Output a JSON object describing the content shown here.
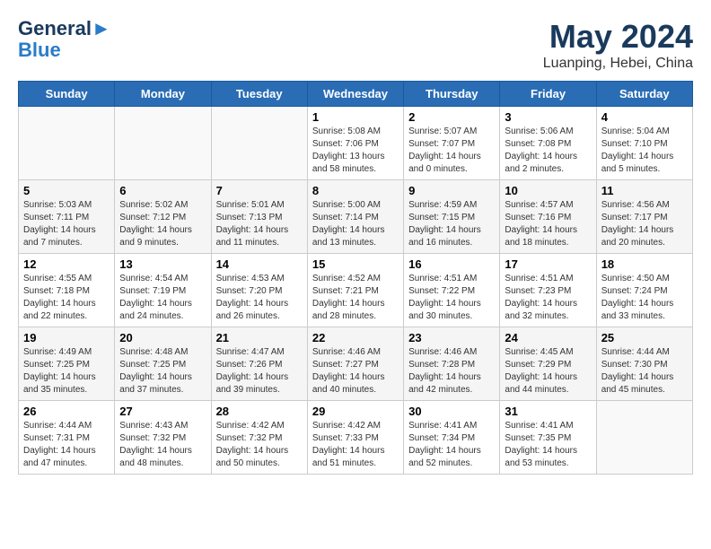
{
  "header": {
    "logo_line1": "General",
    "logo_line2": "Blue",
    "month": "May 2024",
    "location": "Luanping, Hebei, China"
  },
  "weekdays": [
    "Sunday",
    "Monday",
    "Tuesday",
    "Wednesday",
    "Thursday",
    "Friday",
    "Saturday"
  ],
  "weeks": [
    [
      {
        "day": "",
        "info": ""
      },
      {
        "day": "",
        "info": ""
      },
      {
        "day": "",
        "info": ""
      },
      {
        "day": "1",
        "info": "Sunrise: 5:08 AM\nSunset: 7:06 PM\nDaylight: 13 hours\nand 58 minutes."
      },
      {
        "day": "2",
        "info": "Sunrise: 5:07 AM\nSunset: 7:07 PM\nDaylight: 14 hours\nand 0 minutes."
      },
      {
        "day": "3",
        "info": "Sunrise: 5:06 AM\nSunset: 7:08 PM\nDaylight: 14 hours\nand 2 minutes."
      },
      {
        "day": "4",
        "info": "Sunrise: 5:04 AM\nSunset: 7:10 PM\nDaylight: 14 hours\nand 5 minutes."
      }
    ],
    [
      {
        "day": "5",
        "info": "Sunrise: 5:03 AM\nSunset: 7:11 PM\nDaylight: 14 hours\nand 7 minutes."
      },
      {
        "day": "6",
        "info": "Sunrise: 5:02 AM\nSunset: 7:12 PM\nDaylight: 14 hours\nand 9 minutes."
      },
      {
        "day": "7",
        "info": "Sunrise: 5:01 AM\nSunset: 7:13 PM\nDaylight: 14 hours\nand 11 minutes."
      },
      {
        "day": "8",
        "info": "Sunrise: 5:00 AM\nSunset: 7:14 PM\nDaylight: 14 hours\nand 13 minutes."
      },
      {
        "day": "9",
        "info": "Sunrise: 4:59 AM\nSunset: 7:15 PM\nDaylight: 14 hours\nand 16 minutes."
      },
      {
        "day": "10",
        "info": "Sunrise: 4:57 AM\nSunset: 7:16 PM\nDaylight: 14 hours\nand 18 minutes."
      },
      {
        "day": "11",
        "info": "Sunrise: 4:56 AM\nSunset: 7:17 PM\nDaylight: 14 hours\nand 20 minutes."
      }
    ],
    [
      {
        "day": "12",
        "info": "Sunrise: 4:55 AM\nSunset: 7:18 PM\nDaylight: 14 hours\nand 22 minutes."
      },
      {
        "day": "13",
        "info": "Sunrise: 4:54 AM\nSunset: 7:19 PM\nDaylight: 14 hours\nand 24 minutes."
      },
      {
        "day": "14",
        "info": "Sunrise: 4:53 AM\nSunset: 7:20 PM\nDaylight: 14 hours\nand 26 minutes."
      },
      {
        "day": "15",
        "info": "Sunrise: 4:52 AM\nSunset: 7:21 PM\nDaylight: 14 hours\nand 28 minutes."
      },
      {
        "day": "16",
        "info": "Sunrise: 4:51 AM\nSunset: 7:22 PM\nDaylight: 14 hours\nand 30 minutes."
      },
      {
        "day": "17",
        "info": "Sunrise: 4:51 AM\nSunset: 7:23 PM\nDaylight: 14 hours\nand 32 minutes."
      },
      {
        "day": "18",
        "info": "Sunrise: 4:50 AM\nSunset: 7:24 PM\nDaylight: 14 hours\nand 33 minutes."
      }
    ],
    [
      {
        "day": "19",
        "info": "Sunrise: 4:49 AM\nSunset: 7:25 PM\nDaylight: 14 hours\nand 35 minutes."
      },
      {
        "day": "20",
        "info": "Sunrise: 4:48 AM\nSunset: 7:25 PM\nDaylight: 14 hours\nand 37 minutes."
      },
      {
        "day": "21",
        "info": "Sunrise: 4:47 AM\nSunset: 7:26 PM\nDaylight: 14 hours\nand 39 minutes."
      },
      {
        "day": "22",
        "info": "Sunrise: 4:46 AM\nSunset: 7:27 PM\nDaylight: 14 hours\nand 40 minutes."
      },
      {
        "day": "23",
        "info": "Sunrise: 4:46 AM\nSunset: 7:28 PM\nDaylight: 14 hours\nand 42 minutes."
      },
      {
        "day": "24",
        "info": "Sunrise: 4:45 AM\nSunset: 7:29 PM\nDaylight: 14 hours\nand 44 minutes."
      },
      {
        "day": "25",
        "info": "Sunrise: 4:44 AM\nSunset: 7:30 PM\nDaylight: 14 hours\nand 45 minutes."
      }
    ],
    [
      {
        "day": "26",
        "info": "Sunrise: 4:44 AM\nSunset: 7:31 PM\nDaylight: 14 hours\nand 47 minutes."
      },
      {
        "day": "27",
        "info": "Sunrise: 4:43 AM\nSunset: 7:32 PM\nDaylight: 14 hours\nand 48 minutes."
      },
      {
        "day": "28",
        "info": "Sunrise: 4:42 AM\nSunset: 7:32 PM\nDaylight: 14 hours\nand 50 minutes."
      },
      {
        "day": "29",
        "info": "Sunrise: 4:42 AM\nSunset: 7:33 PM\nDaylight: 14 hours\nand 51 minutes."
      },
      {
        "day": "30",
        "info": "Sunrise: 4:41 AM\nSunset: 7:34 PM\nDaylight: 14 hours\nand 52 minutes."
      },
      {
        "day": "31",
        "info": "Sunrise: 4:41 AM\nSunset: 7:35 PM\nDaylight: 14 hours\nand 53 minutes."
      },
      {
        "day": "",
        "info": ""
      }
    ]
  ]
}
